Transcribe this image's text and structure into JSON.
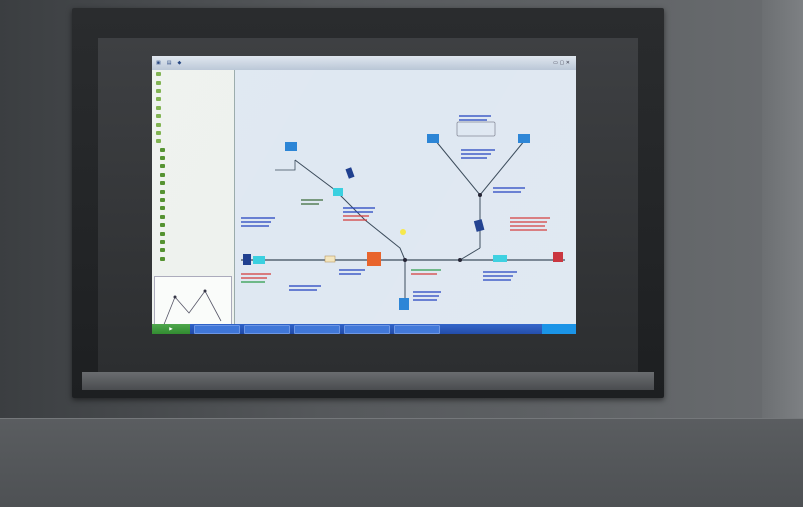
{
  "scene": {
    "description_colors": {
      "wall": "#55585b",
      "bezel": "#1d1f21",
      "screen_background": "#dfe8f2",
      "pipeline": "#3a4a5a",
      "equipment_blue": "#2a84d6",
      "equipment_cyan": "#3ad0e0",
      "equipment_orange": "#e8622a",
      "equipment_red": "#c8303a",
      "label_blue": "#1f3fbf",
      "label_red": "#d43a3a",
      "label_green": "#2a9a4a",
      "taskbar": "#1d48a8",
      "start_button": "#2f8a2e"
    }
  },
  "icons": {
    "folder": "folder-icon",
    "node": "tree-node-icon",
    "valve": "valve-icon",
    "compressor": "compressor-icon",
    "meter": "meter-icon"
  }
}
